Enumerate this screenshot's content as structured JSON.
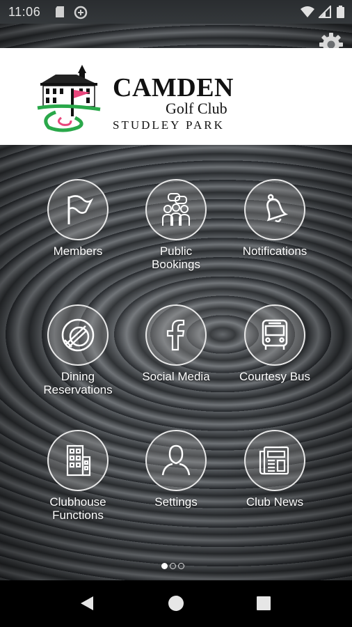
{
  "status_bar": {
    "time": "11:06",
    "left_icons": [
      "sd-card-icon",
      "sync-icon"
    ],
    "right_icons": [
      "wifi-icon",
      "signal-icon",
      "battery-icon"
    ]
  },
  "header": {
    "brand_line1": "CAMDEN",
    "brand_line2": "Golf Club",
    "brand_line3": "STUDLEY PARK",
    "settings_icon": "gear-icon"
  },
  "tiles": [
    {
      "label": "Members",
      "icon": "flag-icon"
    },
    {
      "label": "Public\nBookings",
      "icon": "people-chat-icon"
    },
    {
      "label": "Notifications",
      "icon": "bell-icon"
    },
    {
      "label": "Dining\nReservations",
      "icon": "dining-icon"
    },
    {
      "label": "Social Media",
      "icon": "facebook-icon"
    },
    {
      "label": "Courtesy Bus",
      "icon": "bus-icon"
    },
    {
      "label": "Clubhouse\nFunctions",
      "icon": "building-icon"
    },
    {
      "label": "Settings",
      "icon": "person-icon"
    },
    {
      "label": "Club News",
      "icon": "newspaper-icon"
    }
  ],
  "pager": {
    "pages": 3,
    "current": 1
  },
  "nav_bar": {
    "buttons": [
      "back-icon",
      "home-icon",
      "recents-icon"
    ]
  },
  "colors": {
    "header_bg": "#ffffff",
    "accent_flag": "#e8467c",
    "logo_green": "#2aa84a"
  }
}
